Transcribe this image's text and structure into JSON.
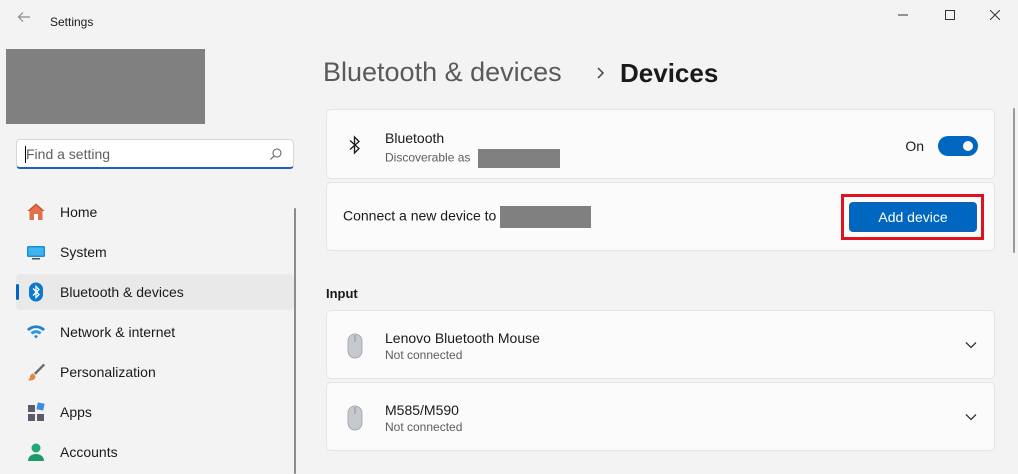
{
  "window": {
    "title": "Settings",
    "controls": [
      "minimize-icon",
      "maximize-icon",
      "close-icon"
    ]
  },
  "sidebar": {
    "search": {
      "placeholder": "Find a setting",
      "value": ""
    },
    "items": [
      {
        "label": "Home",
        "icon": "home-icon",
        "active": false
      },
      {
        "label": "System",
        "icon": "system-icon",
        "active": false
      },
      {
        "label": "Bluetooth & devices",
        "icon": "bluetooth-icon",
        "active": true
      },
      {
        "label": "Network & internet",
        "icon": "network-icon",
        "active": false
      },
      {
        "label": "Personalization",
        "icon": "personalization-icon",
        "active": false
      },
      {
        "label": "Apps",
        "icon": "apps-icon",
        "active": false
      },
      {
        "label": "Accounts",
        "icon": "accounts-icon",
        "active": false
      }
    ]
  },
  "breadcrumb": {
    "parent": "Bluetooth & devices",
    "current": "Devices"
  },
  "bluetooth_card": {
    "title": "Bluetooth",
    "subtitle": "Discoverable as",
    "toggle_label": "On",
    "toggle_on": true
  },
  "connect_card": {
    "text": "Connect a new device to",
    "button_label": "Add device"
  },
  "input_section": {
    "heading": "Input",
    "devices": [
      {
        "name": "Lenovo Bluetooth Mouse",
        "status": "Not connected"
      },
      {
        "name": "M585/M590",
        "status": "Not connected"
      }
    ]
  },
  "colors": {
    "accent": "#0067c0",
    "highlight": "#e0121f",
    "background": "#f3f3f3"
  }
}
